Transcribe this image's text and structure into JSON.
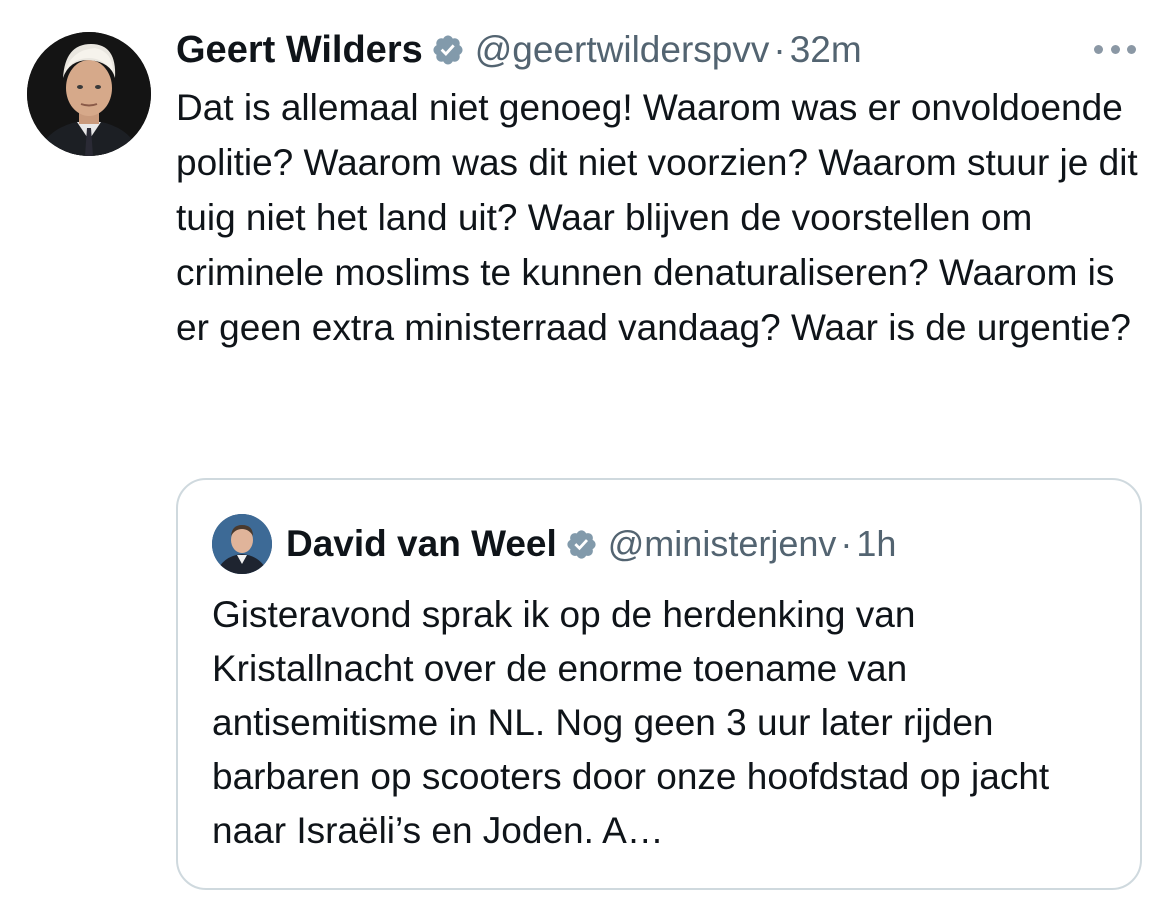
{
  "tweet": {
    "author_name": "Geert Wilders",
    "author_handle": "@geertwilderspvv",
    "separator": "·",
    "time": "32m",
    "text": "Dat is allemaal niet genoeg! Waarom was er onvoldoende politie? Waarom was dit niet voorzien? Waarom stuur je dit tuig niet het land uit? Waar blijven de voorstellen om criminele moslims te kunnen denaturaliseren? Waarom is er geen extra ministerraad vandaag? Waar is de urgentie?",
    "avatar_icon": "profile-photo",
    "verified_icon": "verified-badge-icon",
    "more_icon": "more-options-icon"
  },
  "quoted_tweet": {
    "author_name": "David van Weel",
    "author_handle": "@ministerjenv",
    "separator": "·",
    "time": "1h",
    "text": "Gisteravond sprak ik op de herdenking van Kristallnacht over de enorme toename van antisemitisme in NL. Nog geen 3 uur later rijden barbaren op scooters door onze hoofdstad op jacht naar Israëli’s en Joden. A…",
    "avatar_icon": "profile-photo",
    "verified_icon": "verified-badge-icon"
  },
  "colors": {
    "text_primary": "#0f1419",
    "text_secondary": "#536471",
    "border": "#cfd9de",
    "verified_badge": "#829aab"
  }
}
